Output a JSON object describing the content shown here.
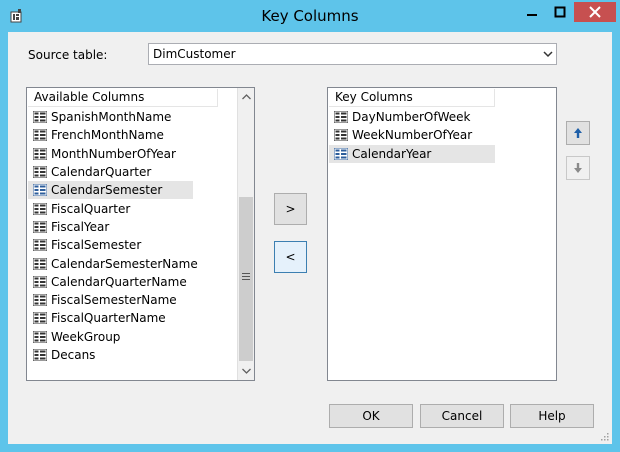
{
  "window": {
    "title": "Key Columns"
  },
  "source_table": {
    "label": "Source table:",
    "value": "DimCustomer"
  },
  "available": {
    "header": "Available Columns",
    "items": [
      "SpanishMonthName",
      "FrenchMonthName",
      "MonthNumberOfYear",
      "CalendarQuarter",
      "CalendarSemester",
      "FiscalQuarter",
      "FiscalYear",
      "FiscalSemester",
      "CalendarSemesterName",
      "CalendarQuarterName",
      "FiscalSemesterName",
      "FiscalQuarterName",
      "WeekGroup",
      "Decans"
    ],
    "selected": "CalendarSemester"
  },
  "key": {
    "header": "Key Columns",
    "items": [
      "DayNumberOfWeek",
      "WeekNumberOfYear",
      "CalendarYear"
    ],
    "selected": "CalendarYear"
  },
  "buttons": {
    "add": ">",
    "remove": "<",
    "ok": "OK",
    "cancel": "Cancel",
    "help": "Help"
  },
  "colors": {
    "title_bar": "#5ec4ea",
    "close_button": "#c75050",
    "dialog_background": "#f0f0f0",
    "selected_row": "#e5e5e5",
    "arrow_blue": "#1e5fa8"
  },
  "icons": {
    "app": "app-icon",
    "minimize": "minimize-icon",
    "maximize": "maximize-icon",
    "close": "close-icon",
    "column": "column-icon",
    "move_up": "arrow-up-icon",
    "move_down": "arrow-down-icon"
  }
}
